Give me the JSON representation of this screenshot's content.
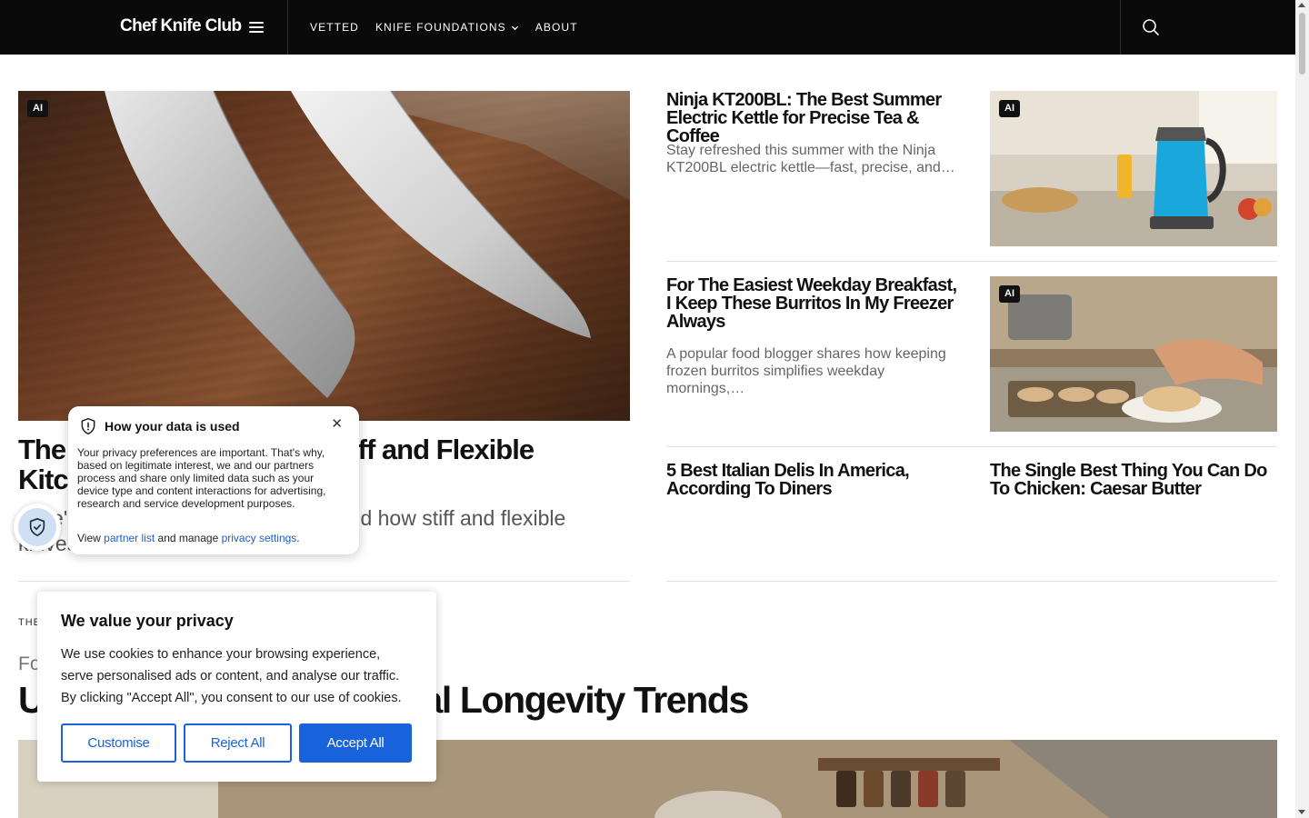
{
  "header": {
    "logo": "Chef Knife Club",
    "nav": [
      {
        "label": "VETTED"
      },
      {
        "label": "KNIFE FOUNDATIONS"
      },
      {
        "label": "ABOUT"
      }
    ]
  },
  "hero": {
    "badge": "AI",
    "title": "The Difference Between Stiff and Flexible Kitchen Blades",
    "excerpt": "Here's what to know about blades and how stiff and flexible knives differ."
  },
  "cards": [
    {
      "badge": "AI",
      "title": "Ninja KT200BL: The Best Summer Electric Kettle for Precise Tea & Coffee",
      "excerpt": "Stay refreshed this summer with the Ninja KT200BL electric kettle—fast, precise, and…"
    },
    {
      "badge": "AI",
      "title": "For The Easiest Weekday Breakfast, I Keep These Burritos In My Freezer Always",
      "excerpt": "A popular food blogger shares how keeping frozen burritos simplifies weekday mornings,…"
    },
    {
      "title": "5 Best Italian Delis In America, According To Diners"
    },
    {
      "title": "The Single Best Thing You Can Do To Chicken: Caesar Butter"
    }
  ],
  "lower": {
    "section_label": "THE LATEST",
    "kicker": "Food",
    "title": "US Food Rankings Reveal Longevity Trends"
  },
  "data_popover": {
    "title": "How your data is used",
    "body": "Your privacy preferences are important. That's why, based on legitimate interest, we and our partners process and share only limited data such as your device type and content interactions for advertising, research and service development purposes.",
    "view": "View",
    "partner_link": "partner list",
    "and_manage": "and manage",
    "privacy_link": "privacy settings",
    "period": ".",
    "close": "✕"
  },
  "cookie_banner": {
    "title": "We value your privacy",
    "text": "We use cookies to enhance your browsing experience, serve personalised ads or content, and analyse our traffic. By clicking \"Accept All\", you consent to our use of cookies.",
    "customise": "Customise",
    "reject": "Reject All",
    "accept": "Accept All"
  },
  "colors": {
    "header_bg": "#0a0a0a",
    "accent_blue": "#1863dc",
    "link_blue": "#1f5fbf"
  }
}
